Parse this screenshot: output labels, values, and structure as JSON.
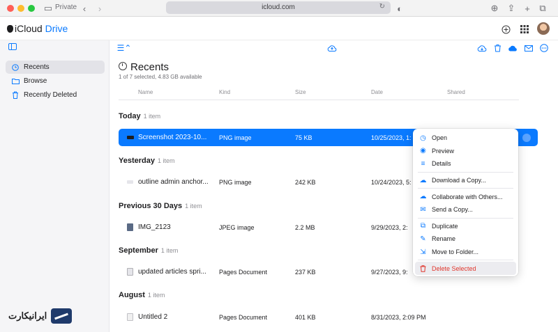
{
  "browser": {
    "private_label": "Private",
    "url": "icloud.com"
  },
  "app": {
    "title_prefix": "iCloud",
    "title_accent": "Drive"
  },
  "sidebar": {
    "items": [
      {
        "label": "Recents",
        "icon": "clock-icon",
        "active": true
      },
      {
        "label": "Browse",
        "icon": "folder-icon",
        "active": false
      },
      {
        "label": "Recently Deleted",
        "icon": "trash-icon",
        "active": false
      }
    ]
  },
  "main": {
    "title": "Recents",
    "subtitle": "1 of 7 selected, 4.83 GB available",
    "columns": [
      "Name",
      "Kind",
      "Size",
      "Date",
      "Shared"
    ],
    "groups": [
      {
        "title": "Today",
        "count": "1 item"
      },
      {
        "title": "Yesterday",
        "count": "1 item"
      },
      {
        "title": "Previous 30 Days",
        "count": "1 item"
      },
      {
        "title": "September",
        "count": "1 item"
      },
      {
        "title": "August",
        "count": "1 item"
      }
    ],
    "files": [
      {
        "name": "Screenshot 2023-10...",
        "kind": "PNG image",
        "size": "75 KB",
        "date": "10/25/2023, 1:"
      },
      {
        "name": "outline admin anchor...",
        "kind": "PNG image",
        "size": "242 KB",
        "date": "10/24/2023, 5:"
      },
      {
        "name": "IMG_2123",
        "kind": "JPEG image",
        "size": "2.2 MB",
        "date": "9/29/2023, 2:"
      },
      {
        "name": "updated articles spri...",
        "kind": "Pages Document",
        "size": "237 KB",
        "date": "9/27/2023, 9:"
      },
      {
        "name": "Untitled 2",
        "kind": "Pages Document",
        "size": "401 KB",
        "date": "8/31/2023, 2:09 PM"
      }
    ]
  },
  "context_menu": {
    "items": [
      {
        "label": "Open",
        "icon": "open-icon"
      },
      {
        "label": "Preview",
        "icon": "eye-icon"
      },
      {
        "label": "Details",
        "icon": "details-icon"
      },
      {
        "label": "Download a Copy...",
        "icon": "download-icon"
      },
      {
        "label": "Collaborate with Others...",
        "icon": "collaborate-icon"
      },
      {
        "label": "Send a Copy...",
        "icon": "envelope-icon"
      },
      {
        "label": "Duplicate",
        "icon": "duplicate-icon"
      },
      {
        "label": "Rename",
        "icon": "pencil-icon"
      },
      {
        "label": "Move to Folder...",
        "icon": "move-folder-icon"
      },
      {
        "label": "Delete Selected",
        "icon": "trash-icon"
      }
    ]
  },
  "watermark": {
    "text": "ایرانیکارت"
  },
  "colors": {
    "accent": "#0a7aff",
    "danger": "#e0352b",
    "selection": "#0a7aff"
  }
}
